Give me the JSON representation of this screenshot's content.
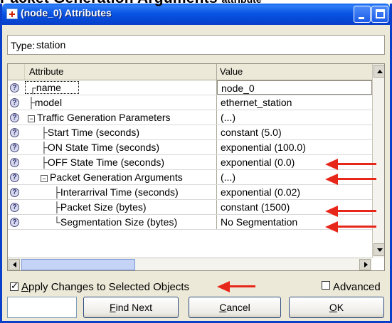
{
  "caption": {
    "big": "Packet Generation Arguments",
    "small": "attribute"
  },
  "window": {
    "title": "(node_0) Attributes"
  },
  "type_field": {
    "label": "Type:",
    "value": "station"
  },
  "table": {
    "headers": {
      "attribute": "Attribute",
      "value": "Value"
    },
    "rows": [
      {
        "name": "name",
        "value": "node_0"
      },
      {
        "name": "model",
        "value": "ethernet_station"
      },
      {
        "name": "Traffic Generation Parameters",
        "value": "(...)"
      },
      {
        "name": "Start Time (seconds)",
        "value": "constant (5.0)"
      },
      {
        "name": "ON State Time (seconds)",
        "value": "exponential (100.0)"
      },
      {
        "name": "OFF State Time (seconds)",
        "value": "exponential (0.0)"
      },
      {
        "name": "Packet Generation Arguments",
        "value": "(...)"
      },
      {
        "name": "Interarrival Time (seconds)",
        "value": "exponential (0.02)"
      },
      {
        "name": "Packet Size (bytes)",
        "value": "constant (1500)"
      },
      {
        "name": "Segmentation Size (bytes)",
        "value": "No Segmentation"
      }
    ]
  },
  "options": {
    "apply_label": "pply Changes to Selected Objects",
    "apply_accel": "A",
    "advanced_label": "vanced",
    "advanced_prefix": "Ad",
    "apply_checked": true,
    "advanced_checked": false
  },
  "buttons": {
    "find_next": {
      "accel": "F",
      "rest": "ind Next"
    },
    "cancel": {
      "accel": "C",
      "rest": "ancel"
    },
    "ok": {
      "accel": "O",
      "rest": "K"
    }
  },
  "colors": {
    "arrow": "#e8271b",
    "titlebar": "#0a55e4"
  }
}
